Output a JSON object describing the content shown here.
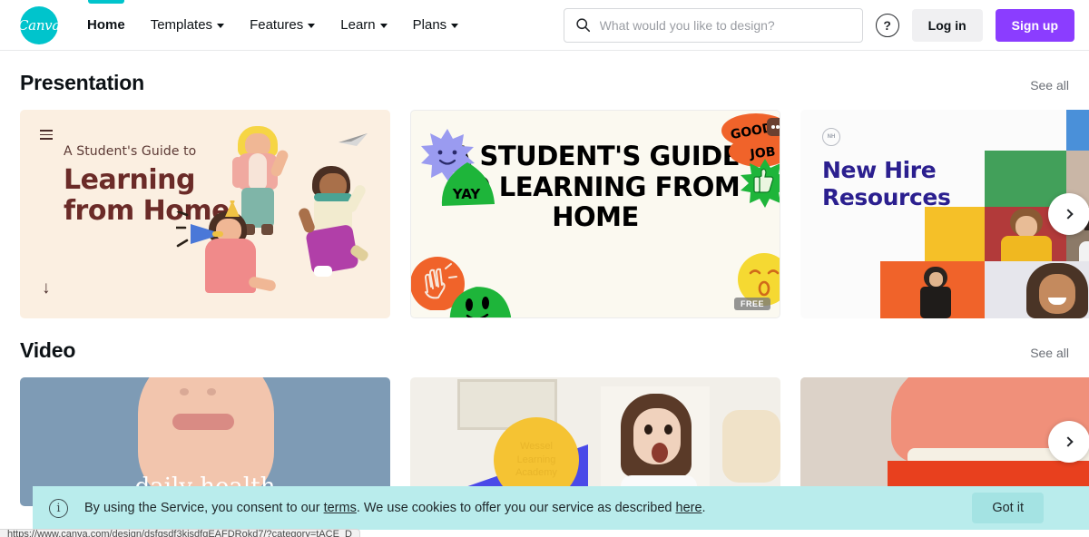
{
  "header": {
    "logo_text": "Canva",
    "nav": [
      {
        "label": "Home",
        "has_caret": false,
        "active": true
      },
      {
        "label": "Templates",
        "has_caret": true,
        "active": false
      },
      {
        "label": "Features",
        "has_caret": true,
        "active": false
      },
      {
        "label": "Learn",
        "has_caret": true,
        "active": false
      },
      {
        "label": "Plans",
        "has_caret": true,
        "active": false
      }
    ],
    "search": {
      "placeholder": "What would you like to design?",
      "value": ""
    },
    "help_label": "?",
    "login_label": "Log in",
    "signup_label": "Sign up",
    "accent_teal": "#00c4cc",
    "accent_purple": "#8b3dff"
  },
  "sections": [
    {
      "title": "Presentation",
      "see_all": "See all"
    },
    {
      "title": "Video",
      "see_all": "See all"
    }
  ],
  "presentation_cards": [
    {
      "name": "learning-from-home",
      "subtitle": "A Student's Guide to",
      "title_line1": "Learning",
      "title_line2": "from Home",
      "background": "#fbefe1",
      "text_color": "#6b2b28"
    },
    {
      "name": "students-guide-poster",
      "poster_text": "A STUDENT'S GUIDE TO LEARNING FROM HOME",
      "background": "#fbf9f0",
      "badge": "FREE",
      "stickers": [
        "YAY",
        "GOOD",
        "JOB"
      ]
    },
    {
      "name": "new-hire-resources",
      "title_line1": "New Hire",
      "title_line2": "Resources",
      "logo_mark": "NH",
      "background": "#fbfbfb",
      "text_color": "#2b1f8f"
    }
  ],
  "video_cards": [
    {
      "name": "beauty-video",
      "caption": "daily health"
    },
    {
      "name": "kids-learning-video",
      "overlay_line1": "Wessel",
      "overlay_line2": "Learning",
      "overlay_line3": "Academy"
    },
    {
      "name": "food-video",
      "caption": ""
    }
  ],
  "carousel": {
    "next_label": "›"
  },
  "cookie_banner": {
    "text_before": "By using the Service, you consent to our ",
    "link_terms": "terms",
    "text_middle": ". We use cookies to offer you our service as described ",
    "link_here": "here",
    "text_after": ".",
    "button_label": "Got it",
    "background": "#b9ecec"
  },
  "status_bar": {
    "url": "https://www.canva.com/design/dsfgsdf3kjsdfgEAFDRokd7/?category=tACE_D"
  }
}
